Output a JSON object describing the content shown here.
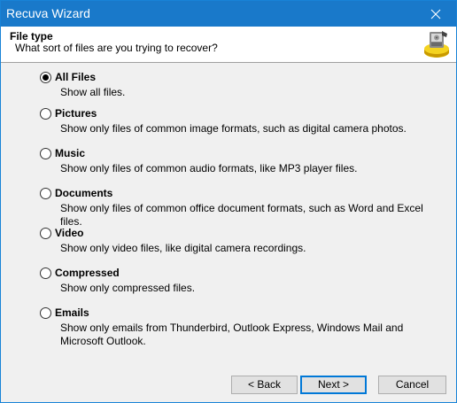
{
  "window": {
    "title": "Recuva Wizard"
  },
  "header": {
    "title": "File type",
    "subtitle": "What sort of files are you trying to recover?",
    "logo_icon": "recuva-logo-icon"
  },
  "options": [
    {
      "label": "All Files",
      "description": "Show all files.",
      "checked": true
    },
    {
      "label": "Pictures",
      "description": "Show only files of common image formats, such as digital camera photos.",
      "checked": false
    },
    {
      "label": "Music",
      "description": "Show only files of common audio formats, like MP3 player files.",
      "checked": false
    },
    {
      "label": "Documents",
      "description": "Show only files of common office document formats, such as Word and Excel files.",
      "checked": false
    },
    {
      "label": "Video",
      "description": "Show only video files, like digital camera recordings.",
      "checked": false
    },
    {
      "label": "Compressed",
      "description": "Show only compressed files.",
      "checked": false
    },
    {
      "label": "Emails",
      "description": "Show only emails from Thunderbird, Outlook Express, Windows Mail and Microsoft Outlook.",
      "checked": false
    }
  ],
  "buttons": {
    "back": "< Back",
    "next": "Next >",
    "cancel": "Cancel"
  },
  "colors": {
    "titlebar": "#1979ca",
    "accent": "#0078d7"
  }
}
